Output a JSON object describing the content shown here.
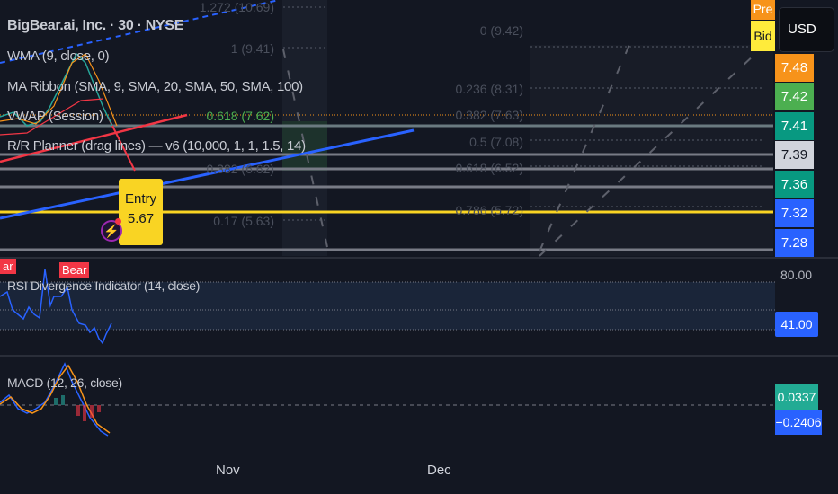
{
  "legend": {
    "symbol": "BigBear.ai, Inc. · 30 · NYSE",
    "indicators": [
      "WMA (9, close, 0)",
      "MA Ribbon (SMA, 9, SMA, 20, SMA, 50, SMA, 100)",
      "VWAP (Session)",
      "R/R Planner (drag lines) — v6 (10,000, 1, 1, 1.5, 14)"
    ]
  },
  "fib_left": [
    "1.272 (10.69)",
    "1 (9.41)",
    "0.618 (7.62)",
    "0.382 (6.62)",
    "0.17 (5.63)"
  ],
  "fib_right": [
    "0 (9.42)",
    "0.236 (8.31)",
    "0.382 (7.63)",
    "0.5 (7.08)",
    "0.618 (6.52)",
    "0.786 (5.72)"
  ],
  "entry": {
    "label": "Entry",
    "price": "5.67"
  },
  "top_badges": {
    "pre": "Pre",
    "bid": "Bid",
    "currency": "USD"
  },
  "price_labels": [
    {
      "value": "7.48",
      "color": "#f7931a"
    },
    {
      "value": "7.42",
      "color": "#4caf50"
    },
    {
      "value": "7.41",
      "color": "#089981"
    },
    {
      "value": "7.39",
      "color": "#d1d4dc"
    },
    {
      "value": "7.36",
      "color": "#089981"
    },
    {
      "value": "7.32",
      "color": "#2962ff"
    },
    {
      "value": "7.28",
      "color": "#2962ff"
    }
  ],
  "rsi": {
    "title": "RSI Divergence Indicator (14, close)",
    "upper": "80.00",
    "value": "41.00",
    "tags": [
      "ar",
      "Bear"
    ]
  },
  "macd": {
    "title": "MACD (12, 26, close)",
    "signal": "0.0337",
    "macd": "−0.2406"
  },
  "time_axis": [
    "Nov",
    "Dec"
  ]
}
